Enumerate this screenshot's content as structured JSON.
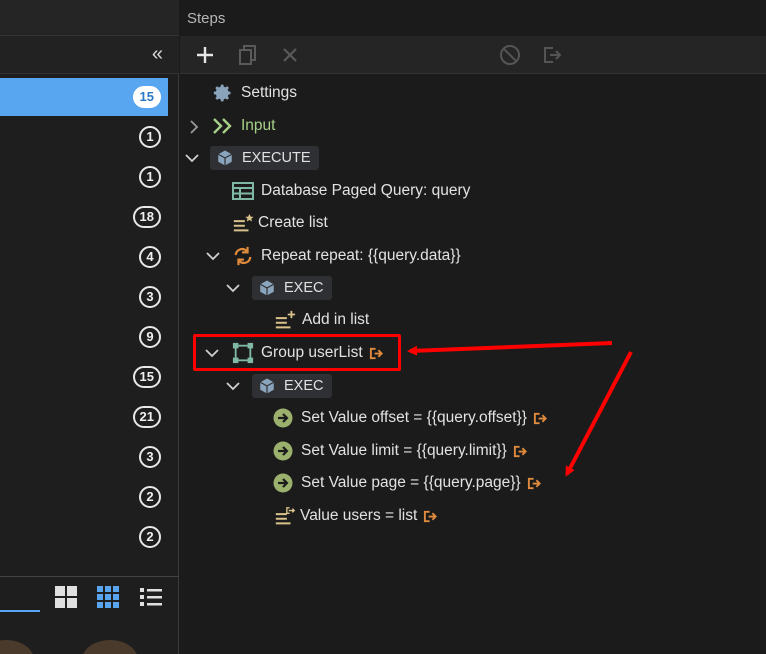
{
  "panels": {
    "steps_title": "Steps",
    "collapse_glyph": "«"
  },
  "left_counts": [
    "15",
    "1",
    "1",
    "18",
    "4",
    "3",
    "9",
    "15",
    "21",
    "3",
    "2",
    "2"
  ],
  "toolbar": {
    "icons": [
      "plus-icon",
      "copy-icon",
      "close-icon",
      "disable-icon",
      "output-icon"
    ]
  },
  "tree": {
    "settings": "Settings",
    "input": "Input",
    "execute": "EXECUTE",
    "db_query": "Database Paged Query: query",
    "create_list": "Create list",
    "repeat": "Repeat repeat: {{query.data}}",
    "exec1": "EXEC",
    "add_in_list": "Add in list",
    "group": "Group userList",
    "exec2": "EXEC",
    "set_offset": "Set Value offset = {{query.offset}}",
    "set_limit": "Set Value limit = {{query.limit}}",
    "set_page": "Set Value page = {{query.page}}",
    "value_users": "Value users = list"
  },
  "colors": {
    "accent_blue": "#58a6f0",
    "annotation_red": "#ff0000",
    "output_orange": "#e08a3c",
    "input_green": "#a6d189"
  }
}
